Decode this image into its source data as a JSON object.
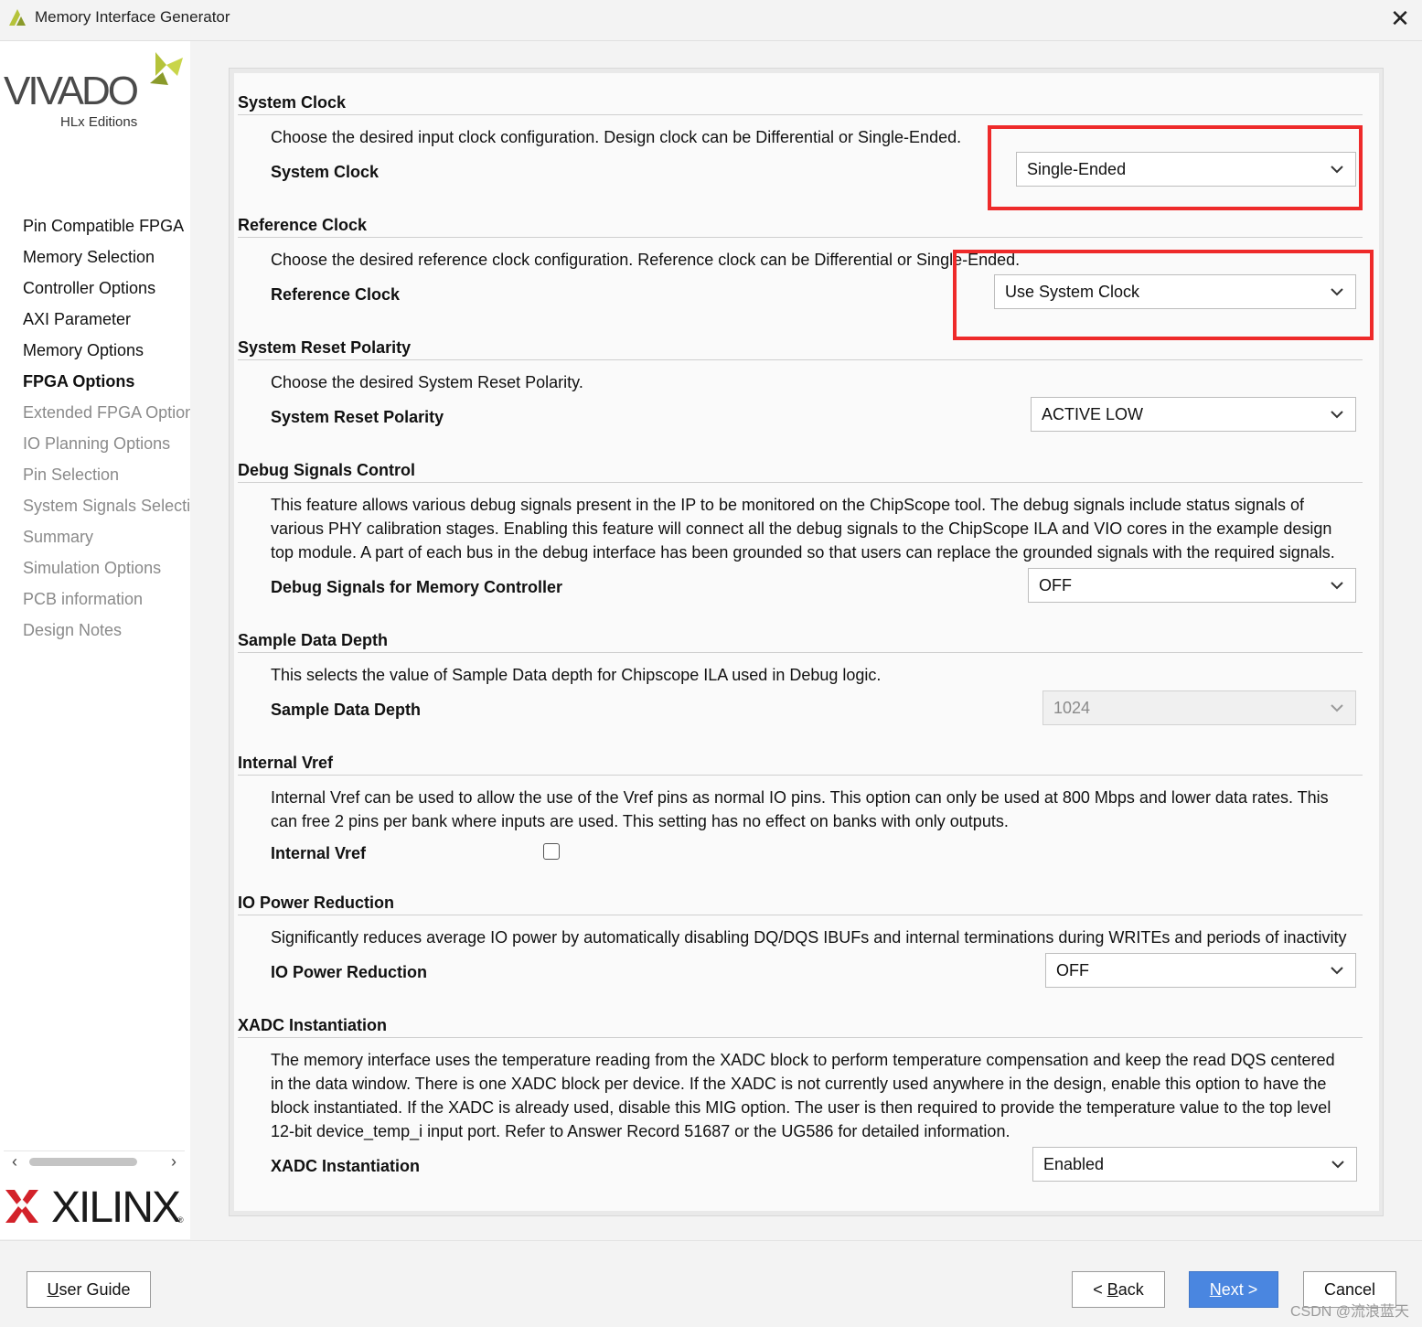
{
  "window": {
    "title": "Memory Interface Generator",
    "close_glyph": "✕",
    "icon": "vivado-app-icon"
  },
  "sidebar": {
    "logo": {
      "brand": "VIVADO",
      "edition": "HLx Editions"
    },
    "items": [
      {
        "label": "Pin Compatible FPGA",
        "state": "done"
      },
      {
        "label": "Memory Selection",
        "state": "done"
      },
      {
        "label": "Controller Options",
        "state": "done"
      },
      {
        "label": "AXI Parameter",
        "state": "done"
      },
      {
        "label": "Memory Options",
        "state": "done"
      },
      {
        "label": "FPGA Options",
        "state": "current"
      },
      {
        "label": "Extended FPGA Options",
        "state": "pending"
      },
      {
        "label": "IO Planning Options",
        "state": "pending"
      },
      {
        "label": "Pin Selection",
        "state": "pending"
      },
      {
        "label": "System Signals Selection",
        "state": "pending"
      },
      {
        "label": "Summary",
        "state": "pending"
      },
      {
        "label": "Simulation Options",
        "state": "pending"
      },
      {
        "label": "PCB information",
        "state": "pending"
      },
      {
        "label": "Design Notes",
        "state": "pending"
      }
    ],
    "scroll_left": "‹",
    "scroll_right": "›",
    "footer_logo": {
      "brand": "XILINX",
      "reg": "®"
    }
  },
  "sections": {
    "system_clock": {
      "title": "System Clock",
      "desc": "Choose the desired input clock configuration. Design clock can be Differential or Single-Ended.",
      "label": "System Clock",
      "value": "Single-Ended"
    },
    "reference_clock": {
      "title": "Reference Clock",
      "desc": "Choose the desired reference clock configuration. Reference clock can be Differential or Single-Ended.",
      "label": "Reference Clock",
      "value": "Use System Clock"
    },
    "reset_polarity": {
      "title": "System Reset Polarity",
      "desc": "Choose the desired System Reset Polarity.",
      "label": "System Reset Polarity",
      "value": "ACTIVE LOW"
    },
    "debug": {
      "title": "Debug Signals Control",
      "desc": "This feature allows various debug signals present in the IP to be monitored on the ChipScope tool. The debug signals include status signals of various PHY calibration stages. Enabling this feature will connect all the debug signals to the ChipScope ILA and VIO cores in the example design top module. A part of each bus in the debug interface has been grounded so that users can replace the grounded signals with the required signals.",
      "label": "Debug Signals for Memory Controller",
      "value": "OFF"
    },
    "sample_depth": {
      "title": "Sample Data Depth",
      "desc": "This selects the value of Sample Data depth for Chipscope ILA used in Debug logic.",
      "label": "Sample Data Depth",
      "value": "1024"
    },
    "internal_vref": {
      "title": "Internal Vref",
      "desc": "Internal Vref can be used to allow the use of the Vref pins as normal IO pins. This option can only be used at 800 Mbps and lower data rates. This can free 2 pins per bank where inputs are used. This setting has no effect on banks with only outputs.",
      "label": "Internal Vref",
      "checked": false
    },
    "io_power": {
      "title": "IO Power Reduction",
      "desc": "Significantly reduces average IO power by automatically disabling DQ/DQS IBUFs and internal terminations during WRITEs and periods of inactivity",
      "label": "IO Power Reduction",
      "value": "OFF"
    },
    "xadc": {
      "title": "XADC Instantiation",
      "desc": "The memory interface uses the temperature reading from the XADC block to perform temperature compensation and keep the read DQS centered in the data window. There is one XADC block per device. If the XADC is not currently used anywhere in the design, enable this option to have the block instantiated. If the XADC is already used, disable this MIG option. The user is then required to provide the temperature value to the top level 12-bit device_temp_i input port. Refer to Answer Record 51687 or the UG586 for detailed information.",
      "label": "XADC Instantiation",
      "value": "Enabled"
    }
  },
  "footer": {
    "user_guide": {
      "mnemonic": "U",
      "rest": "ser Guide"
    },
    "back": {
      "prefix": "< ",
      "mnemonic": "B",
      "rest": "ack"
    },
    "next": {
      "mnemonic": "N",
      "rest": "ext >"
    },
    "cancel": "Cancel"
  },
  "watermark": "CSDN @流浪蓝天",
  "colors": {
    "highlight": "#ee2a2a",
    "primary_button": "#4a86e0",
    "vivado_green": "#b5c33a",
    "xilinx_red": "#d3222a"
  }
}
